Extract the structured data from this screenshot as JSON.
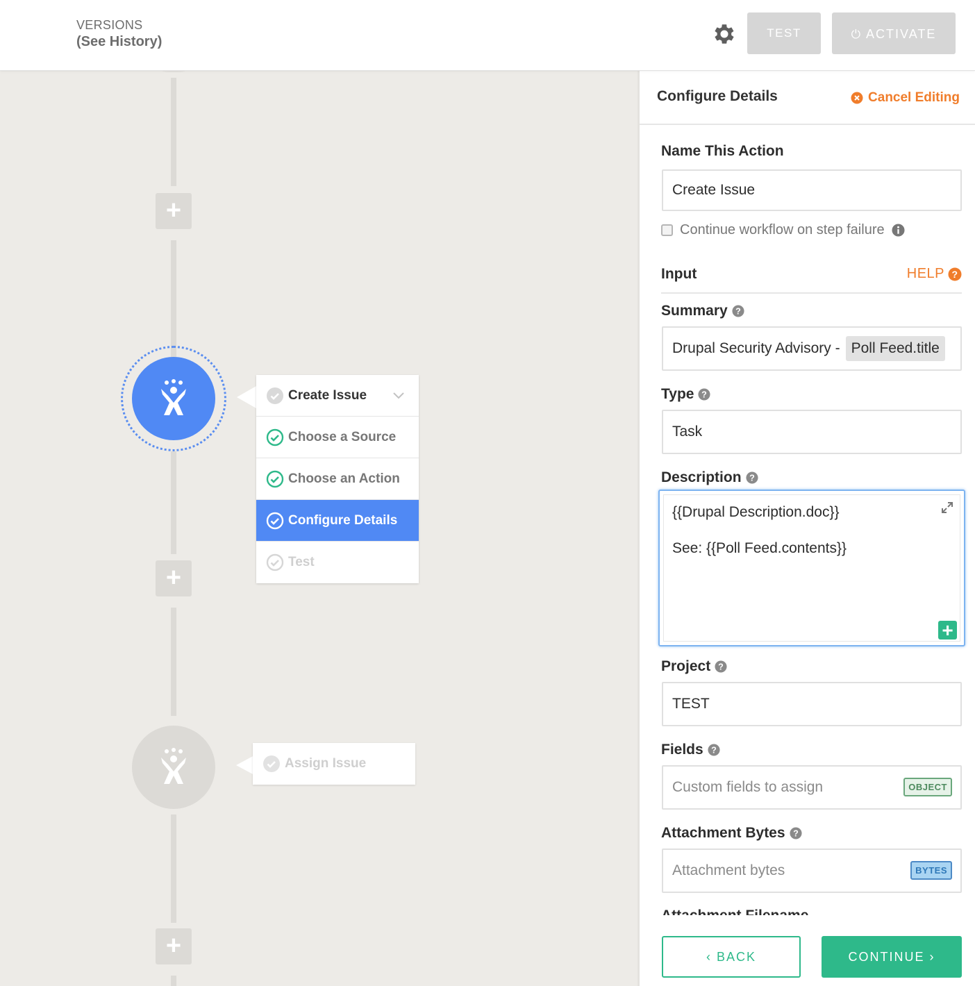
{
  "header": {
    "versions_line1": "VERSIONS",
    "versions_line2": "(See History)",
    "test_button": "TEST",
    "activate_button": "ACTIVATE"
  },
  "canvas": {
    "step_menu": {
      "title": "Create Issue",
      "items": [
        {
          "label": "Choose a Source",
          "state": "done"
        },
        {
          "label": "Choose an Action",
          "state": "done"
        },
        {
          "label": "Configure Details",
          "state": "current"
        },
        {
          "label": "Test",
          "state": "pending"
        }
      ]
    },
    "next_step": {
      "label": "Assign Issue"
    }
  },
  "panel": {
    "title": "Configure Details",
    "cancel_label": "Cancel Editing",
    "name_label": "Name This Action",
    "name_value": "Create Issue",
    "continue_on_failure_label": "Continue workflow on step failure",
    "input_label": "Input",
    "help_label": "HELP",
    "summary": {
      "label": "Summary",
      "text": "Drupal Security Advisory -",
      "pill": "Poll Feed.title"
    },
    "type": {
      "label": "Type",
      "value": "Task"
    },
    "description": {
      "label": "Description",
      "line1": "{{Drupal Description.doc}}",
      "line2": "See: {{Poll Feed.contents}}"
    },
    "project": {
      "label": "Project",
      "value": "TEST"
    },
    "fields": {
      "label": "Fields",
      "placeholder": "Custom fields to assign",
      "tag": "OBJECT"
    },
    "attachment_bytes": {
      "label": "Attachment Bytes",
      "placeholder": "Attachment bytes",
      "tag": "BYTES"
    },
    "attachment_filename": {
      "label": "Attachment Filename"
    },
    "back_button": "‹ BACK",
    "continue_button": "CONTINUE ›"
  },
  "colors": {
    "accent_blue": "#5089f4",
    "accent_green": "#2eb98a",
    "accent_orange": "#f07d2b"
  }
}
